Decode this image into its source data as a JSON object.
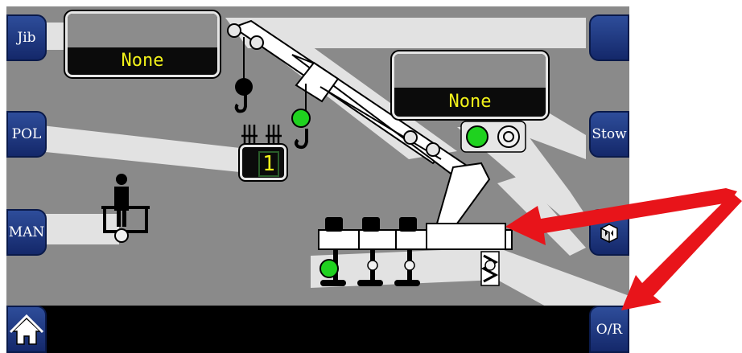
{
  "buttons": {
    "jib": "Jib",
    "pol": "POL",
    "man": "MAN",
    "top_right": "",
    "stow": "Stow",
    "overrun": "O/R"
  },
  "panels": {
    "left_value": "None",
    "right_value": "None"
  },
  "counter": {
    "value": "1"
  },
  "indicators": {
    "active_color": "#1fd21f",
    "inactive_color": "#f2f2f2"
  },
  "colors": {
    "screen_bg": "#8a8a8a",
    "button_blue": "#1d3a86",
    "arrow_red": "#e8141a",
    "display_text": "#f2f21a"
  }
}
